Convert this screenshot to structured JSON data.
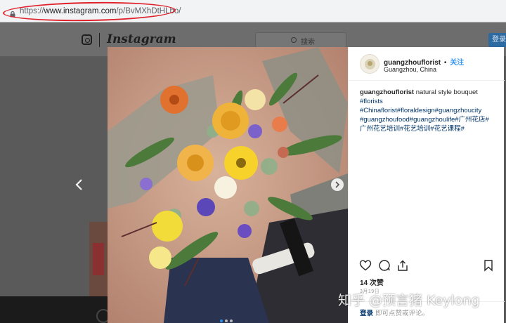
{
  "browser": {
    "url_scheme": "https://",
    "url_host": "www.instagram.com",
    "url_path": "/p/BvMXhDtHLbo/"
  },
  "header": {
    "logo_text": "Instagram",
    "search_placeholder": "搜索",
    "login_button": "登录"
  },
  "post": {
    "username": "guangzhouflorist",
    "separator": "•",
    "follow_label": "关注",
    "location": "Guangzhou, China",
    "caption_user": "guangzhouflorist",
    "caption_text": "natural style bouquet",
    "hashtag_line1": "#florists",
    "hashtag_line2": "#Chinaflorist#floraldesign#guangzhoucity",
    "hashtag_line3": "#guangzhoufood#guangzhoulife#广州花店#",
    "hashtag_line4": "广州花艺培训#花艺培训#花艺课程#",
    "likes": "14 次赞",
    "date": "3月19日",
    "comment_login": "登录",
    "comment_rest": "即可点赞或评论。"
  },
  "carousel": {
    "total": 3,
    "active_index": 0
  },
  "icons": [
    "lock-icon",
    "instagram-camera-icon",
    "search-icon",
    "chevron-left-icon",
    "chevron-right-icon",
    "heart-icon",
    "comment-icon",
    "share-icon",
    "bookmark-icon"
  ],
  "colors": {
    "link": "#003569",
    "follow": "#3897f0",
    "highlight_oval": "#e0202a"
  },
  "watermark": "知乎 @预言猪 Keylong"
}
